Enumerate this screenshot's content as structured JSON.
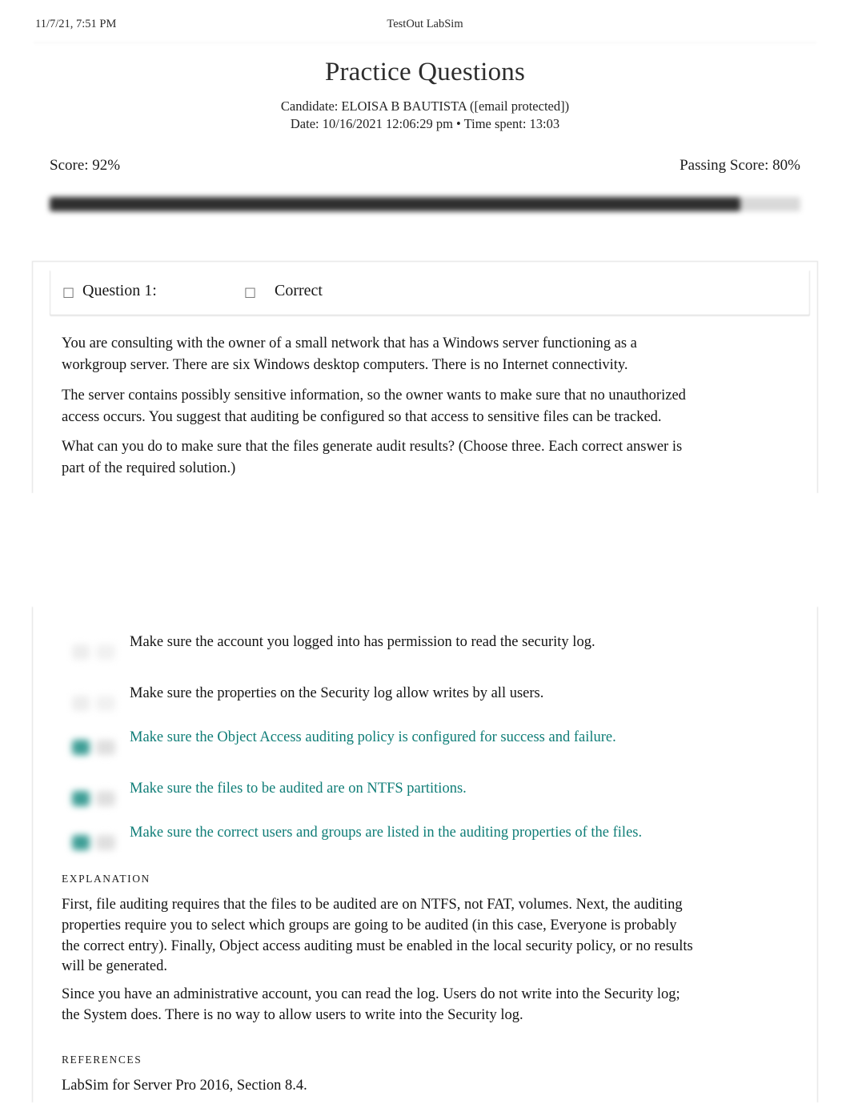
{
  "print_header": {
    "timestamp": "11/7/21, 7:51 PM",
    "site": "TestOut LabSim"
  },
  "title": {
    "heading": "Practice Questions",
    "candidate": "Candidate: ELOISA B BAUTISTA ([email protected])",
    "meta": "Date: 10/16/2021 12:06:29 pm • Time spent: 13:03"
  },
  "score": {
    "score_label": "Score: 92%",
    "passing_label": "Passing Score: 80%",
    "score_percent": 92,
    "passing_percent": 80,
    "bar_fill_color": "#2f2f2f",
    "bar_track_color": "#d9d9d9"
  },
  "question": {
    "number_icon": "missing-glyph-box",
    "number_label": "Question 1:",
    "status_icon": "missing-glyph-box",
    "status_label": "Correct",
    "paragraphs": [
      "You are consulting with the owner of a small network that has a Windows server functioning as a workgroup server. There are six Windows desktop computers. There is no Internet connectivity.",
      "The server contains possibly sensitive information, so the owner wants to make sure that no unauthorized access occurs. You suggest that auditing be configured so that access to sensitive files can be tracked.",
      "What can you do to make sure that the files generate audit results? (Choose three. Each correct answer is part of the required solution.)"
    ]
  },
  "options": [
    {
      "text": "Make sure the account you logged into has permission to read the security log.",
      "correct": false
    },
    {
      "text": "Make sure the properties on the Security log allow writes by all users.",
      "correct": false
    },
    {
      "text": "Make sure the Object Access auditing policy is configured for success and failure.",
      "correct": true
    },
    {
      "text": "Make sure the files to be audited are on NTFS partitions.",
      "correct": true
    },
    {
      "text": "Make sure the correct users and groups are listed in the auditing properties of the files.",
      "correct": true
    }
  ],
  "explanation": {
    "heading": "EXPLANATION",
    "paragraphs": [
      "First, file auditing requires that the files to be audited are on NTFS, not FAT, volumes. Next, the auditing properties require you to select which groups are going to be audited (in this case, Everyone is probably the correct entry). Finally, Object access auditing must be enabled in the local security policy, or no results will be generated.",
      "Since you have an administrative account, you can read the log. Users do not write into the Security log; the System does. There is no way to allow users to write into the Security log."
    ]
  },
  "references": {
    "heading": "REFERENCES",
    "text": "LabSim for Server Pro 2016, Section 8.4."
  },
  "colors": {
    "correct_teal": "#0f7d77",
    "body_text": "#141414",
    "card_border": "#dcdcdc"
  }
}
